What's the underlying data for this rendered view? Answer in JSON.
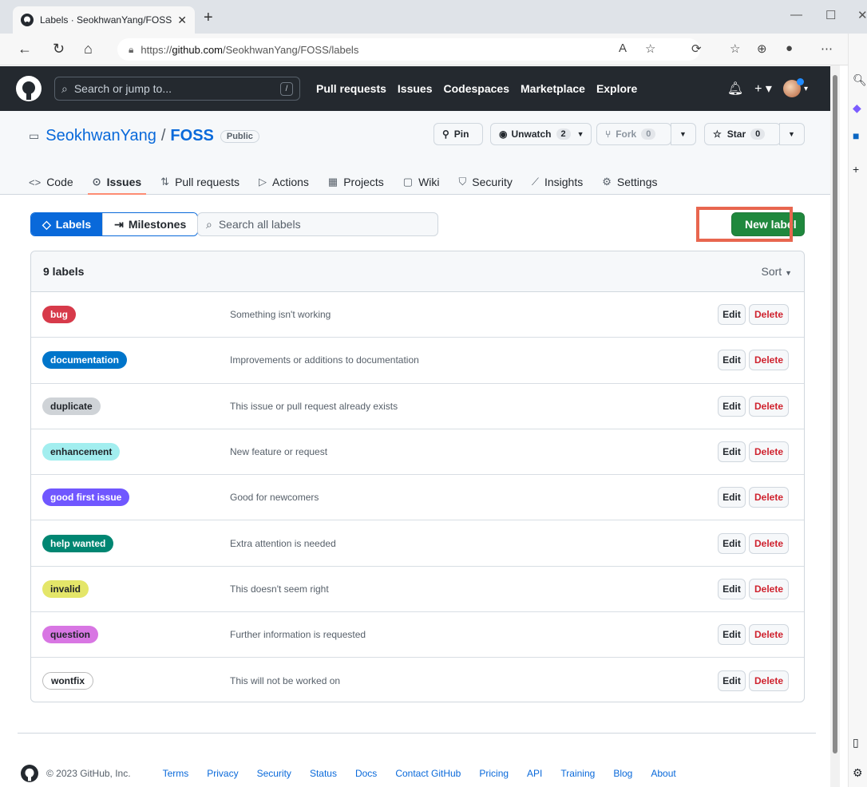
{
  "browser": {
    "tab_title": "Labels · SeokhwanYang/FOSS",
    "url_prefix": "https://",
    "url_domain": "github.com",
    "url_path": "/SeokhwanYang/FOSS/labels"
  },
  "gh": {
    "search_placeholder": "Search or jump to...",
    "search_shortcut": "/",
    "nav": [
      "Pull requests",
      "Issues",
      "Codespaces",
      "Marketplace",
      "Explore"
    ]
  },
  "repo": {
    "owner": "SeokhwanYang",
    "separator": "/",
    "name": "FOSS",
    "visibility": "Public",
    "pin_label": "Pin",
    "unwatch_label": "Unwatch",
    "watch_count": "2",
    "fork_label": "Fork",
    "fork_count": "0",
    "star_label": "Star",
    "star_count": "0",
    "tabs": [
      "Code",
      "Issues",
      "Pull requests",
      "Actions",
      "Projects",
      "Wiki",
      "Security",
      "Insights",
      "Settings"
    ]
  },
  "subnav": {
    "labels": "Labels",
    "milestones": "Milestones",
    "search_placeholder": "Search all labels",
    "new_label": "New label"
  },
  "labels_box": {
    "count": "9 labels",
    "sort": "Sort",
    "edit": "Edit",
    "delete": "Delete",
    "items": [
      {
        "name": "bug",
        "desc": "Something isn't working",
        "bg": "#d73a4a",
        "fg": "#ffffff"
      },
      {
        "name": "documentation",
        "desc": "Improvements or additions to documentation",
        "bg": "#0075ca",
        "fg": "#ffffff"
      },
      {
        "name": "duplicate",
        "desc": "This issue or pull request already exists",
        "bg": "#cfd3d7",
        "fg": "#1f2328"
      },
      {
        "name": "enhancement",
        "desc": "New feature or request",
        "bg": "#a2eeef",
        "fg": "#1f2328"
      },
      {
        "name": "good first issue",
        "desc": "Good for newcomers",
        "bg": "#7057ff",
        "fg": "#ffffff"
      },
      {
        "name": "help wanted",
        "desc": "Extra attention is needed",
        "bg": "#008672",
        "fg": "#ffffff"
      },
      {
        "name": "invalid",
        "desc": "This doesn't seem right",
        "bg": "#e4e669",
        "fg": "#1f2328"
      },
      {
        "name": "question",
        "desc": "Further information is requested",
        "bg": "#d876e3",
        "fg": "#1f2328"
      },
      {
        "name": "wontfix",
        "desc": "This will not be worked on",
        "bg": "#ffffff",
        "fg": "#1f2328"
      }
    ]
  },
  "footer": {
    "copyright": "© 2023 GitHub, Inc.",
    "links": [
      "Terms",
      "Privacy",
      "Security",
      "Status",
      "Docs",
      "Contact GitHub",
      "Pricing",
      "API",
      "Training",
      "Blog",
      "About"
    ]
  }
}
